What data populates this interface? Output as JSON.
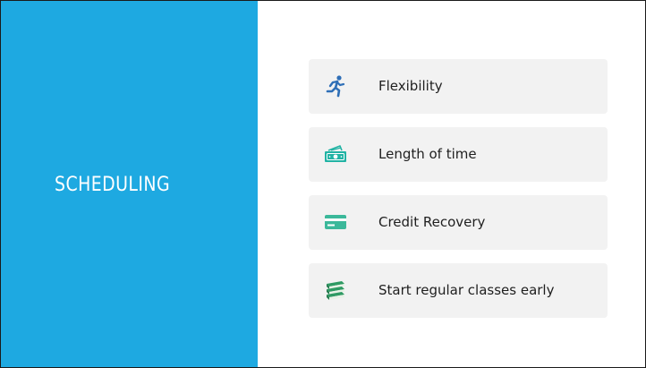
{
  "slide": {
    "title": "SCHEDULING",
    "panel_color": "#1ea9e1"
  },
  "items": [
    {
      "label": "Flexibility",
      "icon": "running-person-icon",
      "icon_color": "#2f6fb7"
    },
    {
      "label": "Length of time",
      "icon": "money-bills-icon",
      "icon_color": "#21b3a4"
    },
    {
      "label": "Credit Recovery",
      "icon": "credit-card-icon",
      "icon_color": "#3bb89a"
    },
    {
      "label": "Start regular classes early",
      "icon": "books-stack-icon",
      "icon_color": "#2e9a63"
    }
  ]
}
